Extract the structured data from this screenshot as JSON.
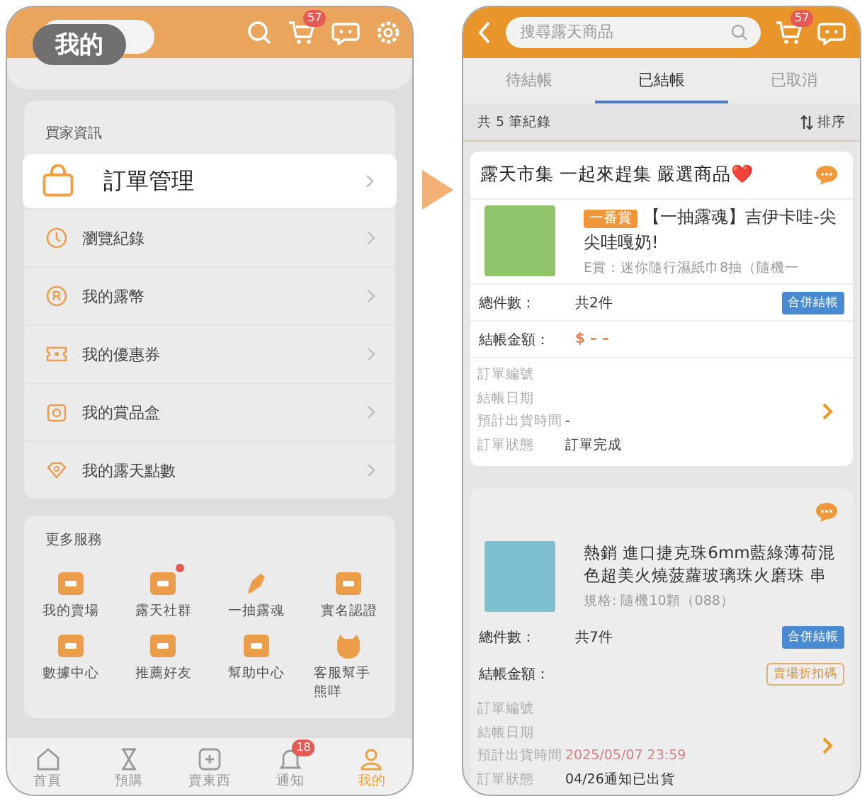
{
  "left_screen": {
    "title_badge": "我的",
    "cart_badge": "57",
    "buyer_info": {
      "heading": "買家資訊",
      "items": [
        {
          "label": "訂單管理",
          "highlighted": true
        },
        {
          "label": "瀏覽紀錄",
          "highlighted": false
        },
        {
          "label": "我的露幣",
          "highlighted": false
        },
        {
          "label": "我的優惠券",
          "highlighted": false
        },
        {
          "label": "我的賞品盒",
          "highlighted": false
        },
        {
          "label": "我的露天點數",
          "highlighted": false
        }
      ]
    },
    "more_services": {
      "heading": "更多服務",
      "items": [
        {
          "label": "我的賣場",
          "dot": false
        },
        {
          "label": "露天社群",
          "dot": true
        },
        {
          "label": "一抽露魂",
          "dot": false
        },
        {
          "label": "實名認證",
          "dot": false
        },
        {
          "label": "數據中心",
          "dot": false
        },
        {
          "label": "推薦好友",
          "dot": false
        },
        {
          "label": "幫助中心",
          "dot": false
        },
        {
          "label": "客服幫手熊咩",
          "dot": false
        }
      ]
    },
    "bottom_nav": [
      {
        "label": "首頁",
        "selected": false
      },
      {
        "label": "預購",
        "selected": false
      },
      {
        "label": "賣東西",
        "selected": false
      },
      {
        "label": "通知",
        "selected": false,
        "badge": "18"
      },
      {
        "label": "我的",
        "selected": true
      }
    ]
  },
  "right_screen": {
    "search": {
      "placeholder": "搜尋露天商品"
    },
    "cart_badge": "57",
    "tabs": [
      {
        "label": "待結帳",
        "selected": false
      },
      {
        "label": "已結帳",
        "selected": true
      },
      {
        "label": "已取消",
        "selected": false
      }
    ],
    "record_count": "共 5 筆紀錄",
    "sort": "排序",
    "orders": [
      {
        "dimmed": false,
        "store": "露天市集 一起來趕集 嚴選商品❤️",
        "tag": "一番賞",
        "title": "【一抽露魂】吉伊卡哇-尖尖哇嘎奶!",
        "spec": "E賞：迷你隨行濕紙巾8抽（隨機一",
        "quantity_label": "總件數：",
        "quantity": "共2件",
        "merge_button": "合併結帳",
        "amount_label": "結帳金額：",
        "amount": "$ – –",
        "details": [
          {
            "label": "訂單編號"
          },
          {
            "label": "結帳日期"
          },
          {
            "label": "預計出貨時間",
            "value": "-"
          },
          {
            "label": "訂單狀態",
            "value": "訂單完成"
          }
        ]
      },
      {
        "dimmed": true,
        "title": "熱銷 進口捷克珠6mm藍綠薄荷混色超美火燒菠蘿玻璃珠火磨珠 串",
        "spec": "規格: 隨機10顆（088）",
        "quantity_label": "總件數：",
        "quantity": "共7件",
        "merge_button": "合併結帳",
        "amount_label": "結帳金額：",
        "discount_button": "賣場折扣碼",
        "details": [
          {
            "label": "訂單編號"
          },
          {
            "label": "結帳日期"
          },
          {
            "label": "預計出貨時間",
            "value": "2025/05/07 23:59",
            "highlight": true
          },
          {
            "label": "訂單狀態",
            "value": "04/26通知已出貨",
            "highlight": false
          }
        ]
      }
    ]
  }
}
